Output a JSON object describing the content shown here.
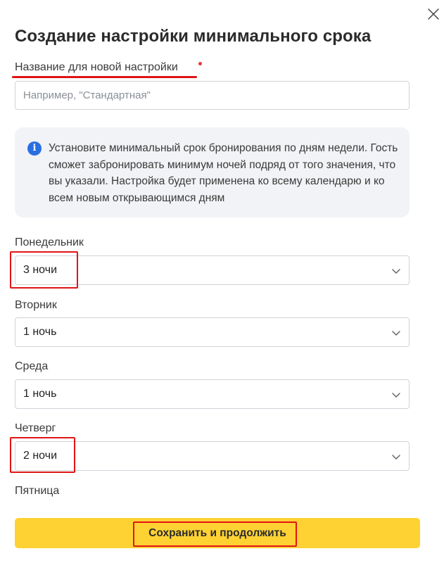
{
  "dialog": {
    "title": "Создание настройки минимального срока",
    "close_icon": "close-icon"
  },
  "name_field": {
    "label": "Название для новой настройки",
    "placeholder": "Например, \"Стандартная\"",
    "value": "",
    "required": true
  },
  "info": {
    "icon": "info-icon",
    "text": "Установите минимальный срок бронирования по дням недели. Гость сможет забронировать минимум ночей подряд от того значения, что вы указали. Настройка будет применена ко всему календарю и ко всем новым открывающимся дням"
  },
  "days": [
    {
      "label": "Понедельник",
      "value": "3 ночи"
    },
    {
      "label": "Вторник",
      "value": "1 ночь"
    },
    {
      "label": "Среда",
      "value": "1 ночь"
    },
    {
      "label": "Четверг",
      "value": "2 ночи"
    },
    {
      "label": "Пятница"
    }
  ],
  "save_button": {
    "label": "Сохранить и продолжить"
  },
  "colors": {
    "accent": "#ffd233",
    "highlight": "#e11414",
    "info_icon": "#2a6fe0",
    "info_bg": "#f2f3f6"
  }
}
